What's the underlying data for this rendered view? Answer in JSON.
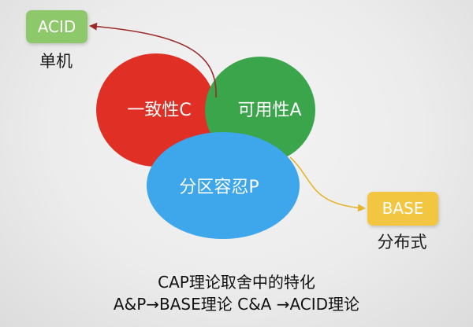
{
  "circles": {
    "consistency": {
      "label": "一致性C",
      "color": "#e02f24"
    },
    "availability": {
      "label": "可用性A",
      "color": "#3aa54a"
    },
    "partition": {
      "label": "分区容忍P",
      "color": "#3ea6ea"
    }
  },
  "acid": {
    "label": "ACID",
    "caption": "单机",
    "color": "#8dc86a"
  },
  "base": {
    "label": "BASE",
    "caption": "分布式",
    "color": "#f2c640"
  },
  "arrows": {
    "to_acid_color": "#9c2a2a",
    "to_base_color": "#e6b52e"
  },
  "footer": {
    "line1": "CAP理论取舍中的特化",
    "line2": "A&P→BASE理论 C&A →ACID理论"
  }
}
